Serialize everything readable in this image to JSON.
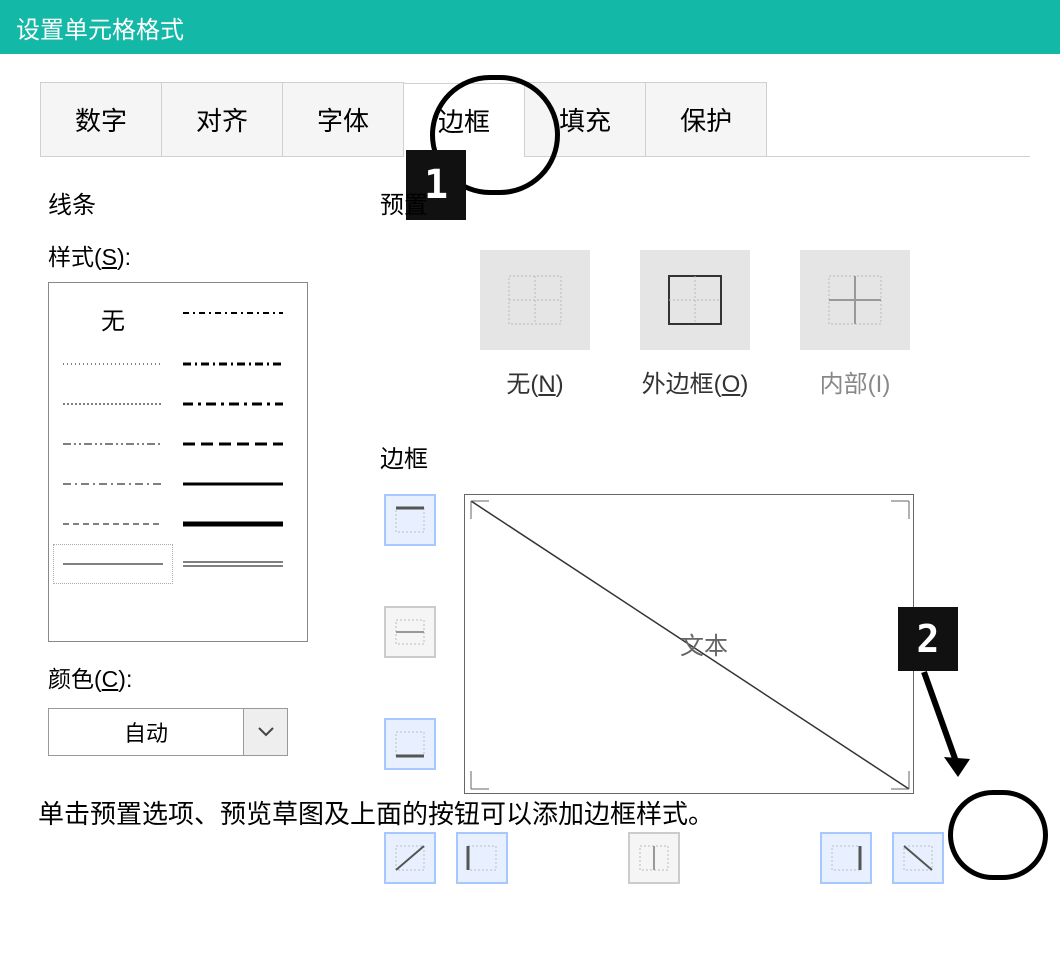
{
  "title": "设置单元格格式",
  "tabs": [
    "数字",
    "对齐",
    "字体",
    "边框",
    "填充",
    "保护"
  ],
  "active_tab": 3,
  "line": {
    "section": "线条",
    "style_label_prefix": "样式(",
    "style_label_key": "S",
    "style_label_suffix": "):",
    "none_label": "无",
    "color_label_prefix": "颜色(",
    "color_label_key": "C",
    "color_label_suffix": "):",
    "color_value": "自动"
  },
  "presets": {
    "section": "预置",
    "none_prefix": "无(",
    "none_key": "N",
    "none_suffix": ")",
    "outline_prefix": "外边框(",
    "outline_key": "O",
    "outline_suffix": ")",
    "inside_prefix": "内部(",
    "inside_key": "I",
    "inside_suffix": ")"
  },
  "border": {
    "section": "边框",
    "preview_text": "文本"
  },
  "callouts": {
    "one": "1",
    "two": "2"
  },
  "help": "单击预置选项、预览草图及上面的按钮可以添加边框样式。"
}
